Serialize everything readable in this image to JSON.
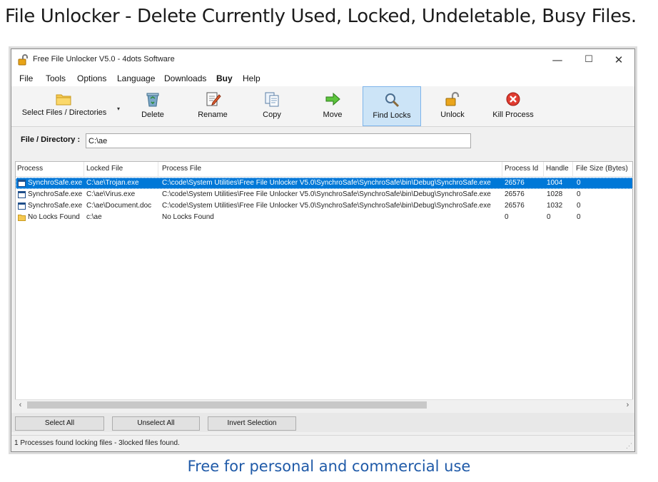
{
  "page": {
    "heading": "File Unlocker - Delete Currently Used, Locked, Undeletable, Busy Files.",
    "footer": "Free for personal and commercial use"
  },
  "window": {
    "title": "Free File Unlocker V5.0 - 4dots Software",
    "controls": {
      "minimize": "—",
      "maximize": "☐",
      "close": "✕"
    }
  },
  "menu": {
    "file": "File",
    "tools": "Tools",
    "options": "Options",
    "language": "Language",
    "downloads": "Downloads",
    "buy": "Buy",
    "help": "Help"
  },
  "toolbar": {
    "select_files": "Select Files / Directories",
    "delete": "Delete",
    "rename": "Rename",
    "copy": "Copy",
    "move": "Move",
    "find_locks": "Find Locks",
    "unlock": "Unlock",
    "kill_process": "Kill Process",
    "dropdown_arrow": "▾"
  },
  "path": {
    "label": "File / Directory :",
    "value": "C:\\ae"
  },
  "list": {
    "columns": [
      "Process",
      "Locked File",
      "Process File",
      "Process Id",
      "Handle",
      "File Size (Bytes)"
    ],
    "rows": [
      {
        "process": "SynchroSafe.exe",
        "locked_file": "C:\\ae\\Trojan.exe",
        "process_file": "C:\\code\\System Utilities\\Free File Unlocker V5.0\\SynchroSafe\\SynchroSafe\\bin\\Debug\\SynchroSafe.exe",
        "process_id": "26576",
        "handle": "1004",
        "file_size": "0",
        "icon": "window-app-icon",
        "selected": true
      },
      {
        "process": "SynchroSafe.exe",
        "locked_file": "C:\\ae\\Virus.exe",
        "process_file": "C:\\code\\System Utilities\\Free File Unlocker V5.0\\SynchroSafe\\SynchroSafe\\bin\\Debug\\SynchroSafe.exe",
        "process_id": "26576",
        "handle": "1028",
        "file_size": "0",
        "icon": "window-app-icon",
        "selected": false
      },
      {
        "process": "SynchroSafe.exe",
        "locked_file": "C:\\ae\\Document.doc",
        "process_file": "C:\\code\\System Utilities\\Free File Unlocker V5.0\\SynchroSafe\\SynchroSafe\\bin\\Debug\\SynchroSafe.exe",
        "process_id": "26576",
        "handle": "1032",
        "file_size": "0",
        "icon": "window-app-icon",
        "selected": false
      },
      {
        "process": "No Locks Found",
        "locked_file": "c:\\ae",
        "process_file": "No Locks Found",
        "process_id": "0",
        "handle": "0",
        "file_size": "0",
        "icon": "folder-icon",
        "selected": false
      }
    ]
  },
  "scrollbar": {
    "left_arrow": "‹",
    "right_arrow": "›"
  },
  "buttons": {
    "select_all": "Select All",
    "unselect_all": "Unselect All",
    "invert_selection": "Invert Selection"
  },
  "status": {
    "text": "1 Processes found locking files - 3locked files found.",
    "grip": "⋰"
  },
  "colors": {
    "selection": "#0078d7",
    "active_tool": "#cce4f7",
    "footer_text": "#1f5aa8"
  }
}
